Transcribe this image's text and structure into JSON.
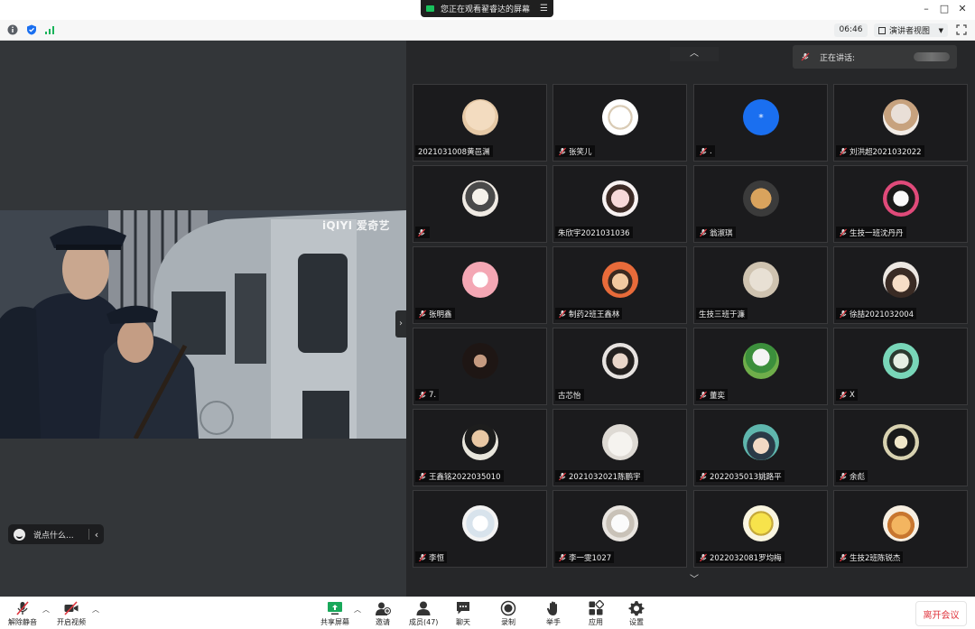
{
  "titlebar": {
    "share_notice": "您正在观看翟睿达的屏幕"
  },
  "infobar": {
    "timer": "06:46",
    "view_label": "演讲者视图"
  },
  "shared_screen": {
    "watermark": "iQIYI 爱奇艺"
  },
  "chat": {
    "placeholder": "说点什么..."
  },
  "speaking": {
    "label": "正在讲话:"
  },
  "participants": [
    {
      "name": "2021031008黄邑渊",
      "muted": false,
      "avatar": "cartoon-avatar"
    },
    {
      "name": "张笑儿",
      "muted": true,
      "avatar": "sketch-avatar"
    },
    {
      "name": ".",
      "muted": true,
      "avatar": "blue-dot-avatar"
    },
    {
      "name": "刘洪超2021032022",
      "muted": true,
      "avatar": "photo-avatar"
    },
    {
      "name": "",
      "muted": true,
      "avatar": "anime-avatar"
    },
    {
      "name": "朱欣宇2021031036",
      "muted": false,
      "avatar": "girl-avatar"
    },
    {
      "name": "翁淑琪",
      "muted": true,
      "avatar": "toast-avatar"
    },
    {
      "name": "生技一班沈丹丹",
      "muted": true,
      "avatar": "mask-avatar"
    },
    {
      "name": "张明鑫",
      "muted": true,
      "avatar": "pink-avatar"
    },
    {
      "name": "制药2班王鑫林",
      "muted": true,
      "avatar": "cartoon-boy-avatar"
    },
    {
      "name": "生技三班于濂",
      "muted": false,
      "avatar": "cat-avatar"
    },
    {
      "name": "徐喆2021032004",
      "muted": true,
      "avatar": "anime-boy-avatar"
    },
    {
      "name": "7.",
      "muted": true,
      "avatar": "dark-girl-avatar"
    },
    {
      "name": "古芯怡",
      "muted": false,
      "avatar": "photo-girl-avatar"
    },
    {
      "name": "董奕",
      "muted": true,
      "avatar": "duck-avatar"
    },
    {
      "name": "X",
      "muted": true,
      "avatar": "green-anime-avatar"
    },
    {
      "name": "王鑫铭2022035010",
      "muted": true,
      "avatar": "boy-laptop-avatar"
    },
    {
      "name": "2021032021陈鹏宇",
      "muted": true,
      "avatar": "bear-avatar"
    },
    {
      "name": "2022035013姚路平",
      "muted": true,
      "avatar": "teal-anime-avatar"
    },
    {
      "name": "余彪",
      "muted": true,
      "avatar": "bw-anime-avatar"
    },
    {
      "name": "李恒",
      "muted": true,
      "avatar": "pale-anime-avatar"
    },
    {
      "name": "李一雯1027",
      "muted": true,
      "avatar": "dog-avatar"
    },
    {
      "name": "2022032081罗均梅",
      "muted": true,
      "avatar": "sponge-avatar"
    },
    {
      "name": "生技2班陈锐杰",
      "muted": true,
      "avatar": "fox-avatar"
    }
  ],
  "toolbar": {
    "unmute": "解除静音",
    "start_video": "开启视频",
    "share_screen": "共享屏幕",
    "invite": "邀请",
    "members": "成员(47)",
    "chat": "聊天",
    "record": "录制",
    "raise_hand": "举手",
    "apps": "应用",
    "settings": "设置",
    "leave": "离开会议"
  },
  "colors": {
    "leave_red": "#e0343d",
    "gallery_bg": "#262729",
    "share_bg": "#333639",
    "accent_blue": "#1a6ff0"
  }
}
